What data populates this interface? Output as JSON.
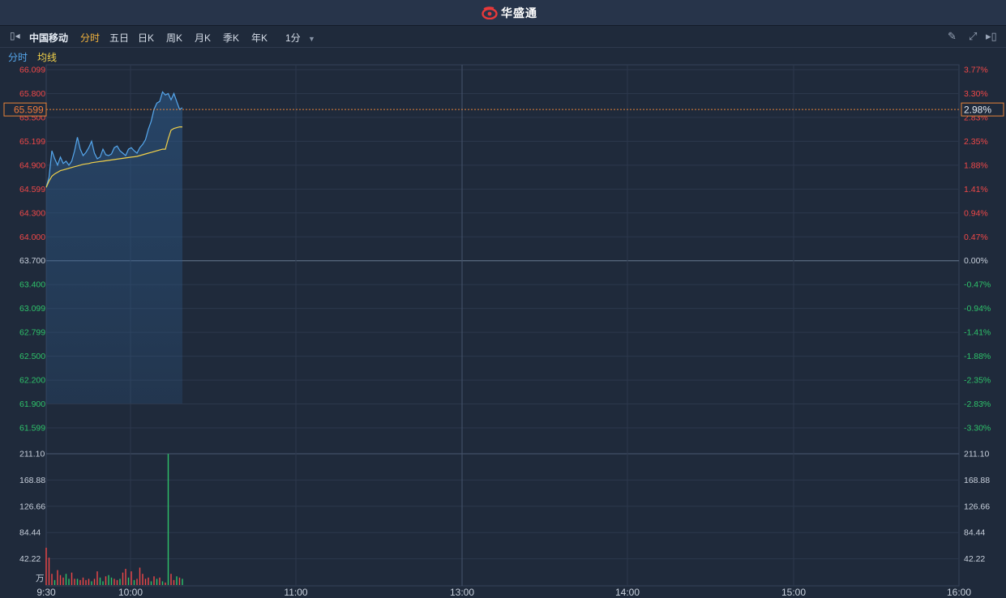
{
  "brand": {
    "name": "华盛通",
    "logo_icon": "bird-logo-icon"
  },
  "toolbar": {
    "left_icon": "collapse-left-icon",
    "stock_name": "中国移动",
    "tabs": [
      "分时",
      "五日",
      "日K",
      "周K",
      "月K",
      "季K",
      "年K"
    ],
    "active_tab": "分时",
    "interval": "1分",
    "right_icons": [
      "pencil-icon",
      "expand-icon",
      "collapse-right-icon"
    ]
  },
  "legend": {
    "line": "分时",
    "avg": "均线"
  },
  "colors": {
    "price_line": "#56a8ee",
    "avg_line": "#f3d24a",
    "up": "#f04848",
    "down": "#2ec26a",
    "neutral": "#c8d0dc"
  },
  "chart_data": {
    "type": "line",
    "prev_close": 63.7,
    "last_price": "65.599",
    "last_pct": "2.98%",
    "x_ticks": [
      "9:30",
      "10:00",
      "11:00",
      "13:00",
      "14:00",
      "15:00",
      "16:00"
    ],
    "y_ticks": [
      {
        "price": "66.099",
        "pct": "3.77%",
        "dir": "up"
      },
      {
        "price": "65.800",
        "pct": "3.30%",
        "dir": "up"
      },
      {
        "price": "65.500",
        "pct": "2.83%",
        "dir": "up"
      },
      {
        "price": "65.199",
        "pct": "2.35%",
        "dir": "up"
      },
      {
        "price": "64.900",
        "pct": "1.88%",
        "dir": "up"
      },
      {
        "price": "64.599",
        "pct": "1.41%",
        "dir": "up"
      },
      {
        "price": "64.300",
        "pct": "0.94%",
        "dir": "up"
      },
      {
        "price": "64.000",
        "pct": "0.47%",
        "dir": "up"
      },
      {
        "price": "63.700",
        "pct": "0.00%",
        "dir": "flat"
      },
      {
        "price": "63.400",
        "pct": "-0.47%",
        "dir": "down"
      },
      {
        "price": "63.099",
        "pct": "-0.94%",
        "dir": "down"
      },
      {
        "price": "62.799",
        "pct": "-1.41%",
        "dir": "down"
      },
      {
        "price": "62.500",
        "pct": "-1.88%",
        "dir": "down"
      },
      {
        "price": "62.200",
        "pct": "-2.35%",
        "dir": "down"
      },
      {
        "price": "61.900",
        "pct": "-2.83%",
        "dir": "down"
      },
      {
        "price": "61.599",
        "pct": "-3.30%",
        "dir": "down"
      }
    ],
    "ylim": [
      61.599,
      66.099
    ],
    "price": [
      64.62,
      64.75,
      65.08,
      64.98,
      64.9,
      65.0,
      64.92,
      64.95,
      64.9,
      64.95,
      65.08,
      65.25,
      65.1,
      65.02,
      65.06,
      65.12,
      65.2,
      65.05,
      64.98,
      65.0,
      65.1,
      65.03,
      65.02,
      65.04,
      65.12,
      65.14,
      65.08,
      65.05,
      65.02,
      65.1,
      65.12,
      65.08,
      65.05,
      65.12,
      65.16,
      65.22,
      65.35,
      65.45,
      65.6,
      65.68,
      65.7,
      65.82,
      65.78,
      65.8,
      65.72,
      65.8,
      65.7,
      65.6,
      65.62
    ],
    "avg": [
      64.62,
      64.7,
      64.76,
      64.79,
      64.81,
      64.83,
      64.84,
      64.85,
      64.86,
      64.87,
      64.88,
      64.89,
      64.9,
      64.91,
      64.915,
      64.92,
      64.93,
      64.935,
      64.94,
      64.945,
      64.95,
      64.955,
      64.96,
      64.965,
      64.97,
      64.975,
      64.98,
      64.985,
      64.99,
      64.995,
      65.0,
      65.005,
      65.01,
      65.02,
      65.03,
      65.04,
      65.05,
      65.06,
      65.07,
      65.08,
      65.09,
      65.1,
      65.1,
      65.23,
      65.34,
      65.36,
      65.37,
      65.38,
      65.38
    ],
    "volume_ticks": [
      "211.10",
      "168.88",
      "126.66",
      "84.44",
      "42.22"
    ],
    "volume_unit": "万",
    "volume_max": 211.1,
    "volume": [
      60,
      44,
      18,
      8,
      24,
      16,
      12,
      18,
      10,
      20,
      10,
      10,
      8,
      12,
      8,
      10,
      6,
      10,
      22,
      12,
      6,
      14,
      16,
      12,
      10,
      8,
      10,
      20,
      26,
      12,
      22,
      8,
      10,
      28,
      18,
      10,
      12,
      6,
      14,
      10,
      12,
      6,
      4,
      211,
      18,
      8,
      14,
      12,
      10
    ],
    "volume_dir": [
      "up",
      "up",
      "up",
      "down",
      "up",
      "up",
      "up",
      "down",
      "down",
      "up",
      "up",
      "down",
      "up",
      "up",
      "up",
      "up",
      "down",
      "up",
      "up",
      "down",
      "down",
      "up",
      "down",
      "down",
      "up",
      "up",
      "down",
      "up",
      "up",
      "down",
      "up",
      "down",
      "up",
      "up",
      "up",
      "up",
      "up",
      "down",
      "up",
      "down",
      "up",
      "down",
      "up",
      "down",
      "up",
      "up",
      "down",
      "up",
      "down"
    ]
  }
}
